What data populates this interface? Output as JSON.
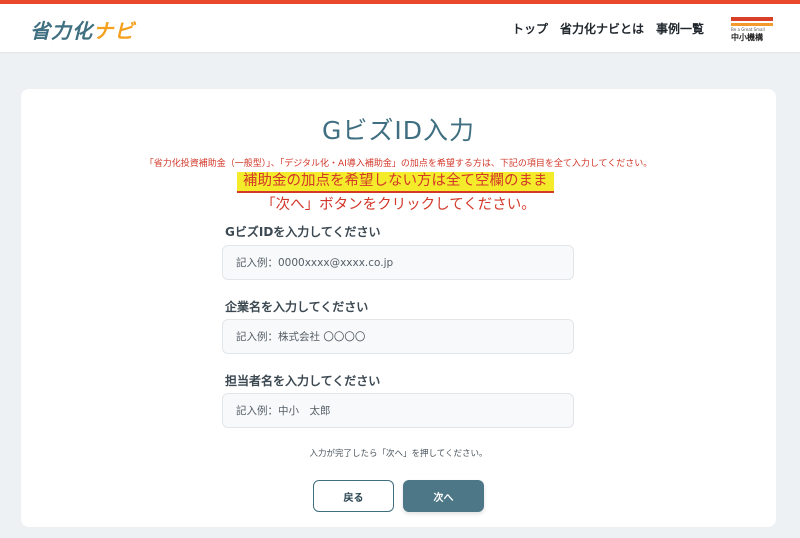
{
  "header": {
    "logo_main": "省力化",
    "logo_accent": "ナビ",
    "nav": [
      "トップ",
      "省力化ナビとは",
      "事例一覧"
    ],
    "org_tagline": "Be a Great Small",
    "org_name": "中小機構"
  },
  "page": {
    "title": "GビズID入力",
    "note": "「省力化投資補助金（一般型）」、「デジタル化・AI導入補助金」の加点を希望する方は、下記の項目を全て入力してください。",
    "highlight": "補助金の加点を希望しない方は全て空欄のまま",
    "instruction": "「次へ」ボタンをクリックしてください。"
  },
  "form": {
    "fields": [
      {
        "label": "GビズIDを入力してください",
        "placeholder": "記入例：0000xxxx@xxxx.co.jp",
        "value": ""
      },
      {
        "label": "企業名を入力してください",
        "placeholder": "記入例：株式会社 〇〇〇〇",
        "value": ""
      },
      {
        "label": "担当者名を入力してください",
        "placeholder": "記入例：中小　太郎",
        "value": ""
      }
    ],
    "help": "入力が完了したら「次へ」を押してください。",
    "back_label": "戻る",
    "next_label": "次へ"
  },
  "colors": {
    "accent": "#3f6f80",
    "warning": "#d3382a",
    "highlight": "#f4ec2b",
    "primary_button": "#4d7686",
    "brand_stripe": "#e8482b"
  }
}
